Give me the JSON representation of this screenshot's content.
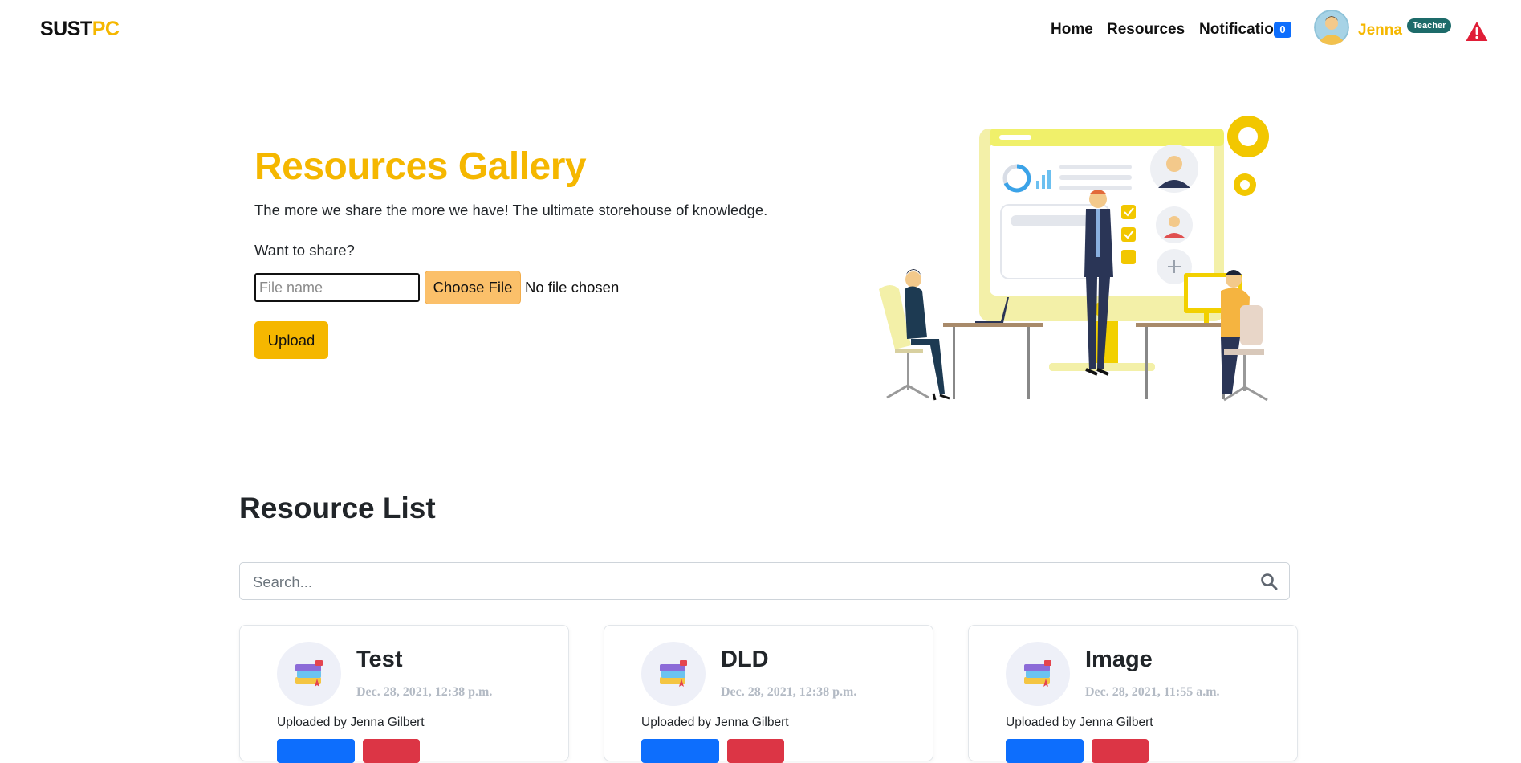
{
  "brand": {
    "part1": "SUST",
    "part2": "PC",
    "accent_color": "#f5b700"
  },
  "nav": {
    "home": "Home",
    "resources": "Resources",
    "notification": "Notification",
    "notification_count": "0"
  },
  "user": {
    "name": "Jenna",
    "role": "Teacher",
    "avatar_icon": "user-avatar-icon"
  },
  "alert_icon": "warning-triangle-icon",
  "hero": {
    "title": "Resources Gallery",
    "subtitle": "The more we share the more we have! The ultimate storehouse of knowledge.",
    "share_prompt": "Want to share?",
    "file_name_placeholder": "File name",
    "file_name_value": "",
    "choose_file_label": "Choose File",
    "no_file_text": "No file chosen",
    "upload_label": "Upload",
    "illustration_icon": "office-team-illustration"
  },
  "resource_list": {
    "title": "Resource List",
    "search_placeholder": "Search...",
    "search_icon": "search-icon",
    "cards": [
      {
        "title": "Test",
        "date": "Dec. 28, 2021, 12:38 p.m.",
        "uploader": "Uploaded by Jenna Gilbert",
        "icon": "books-icon"
      },
      {
        "title": "DLD",
        "date": "Dec. 28, 2021, 12:38 p.m.",
        "uploader": "Uploaded by Jenna Gilbert",
        "icon": "books-icon"
      },
      {
        "title": "Image",
        "date": "Dec. 28, 2021, 11:55 a.m.",
        "uploader": "Uploaded by Jenna Gilbert",
        "icon": "books-icon"
      }
    ]
  },
  "colors": {
    "accent": "#f5b700",
    "primary_button": "#0d6efd",
    "danger_button": "#dc3545",
    "badge_teal": "#1d6b6a"
  }
}
